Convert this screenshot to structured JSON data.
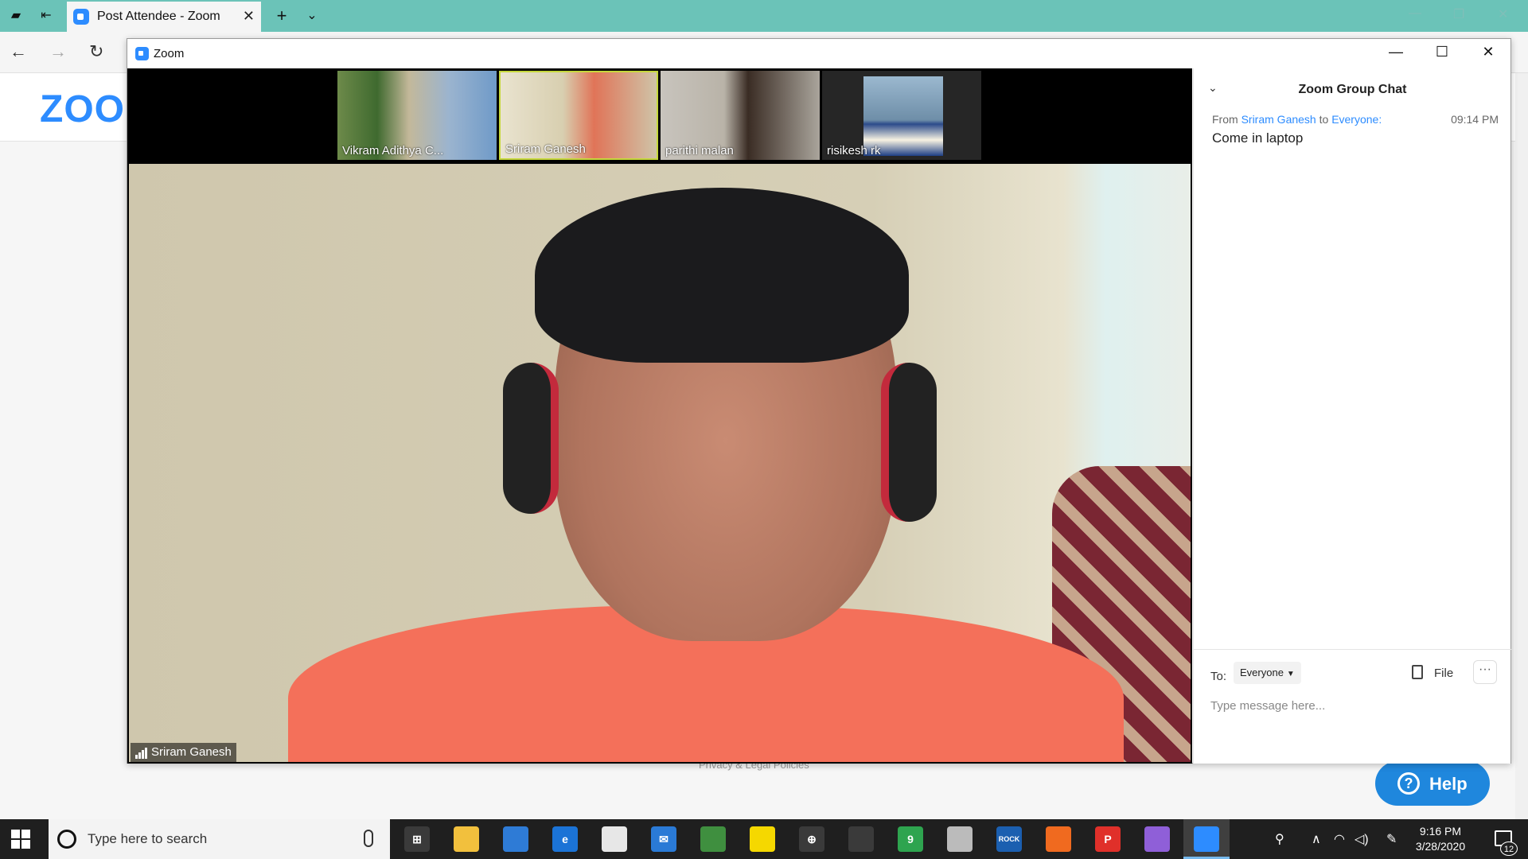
{
  "browser": {
    "tab_title": "Post Attendee - Zoom"
  },
  "page": {
    "logo_text": "ZOOM",
    "footer_link": "Privacy & Legal Policies",
    "help_label": "Help",
    "help_icon": "?"
  },
  "zoom_window": {
    "title": "Zoom",
    "participants": [
      {
        "name": "Vikram Adithya C..."
      },
      {
        "name": "Sriram Ganesh"
      },
      {
        "name": "parithi malan"
      },
      {
        "name": "risikesh rk"
      }
    ],
    "active_speaker": "Sriram Ganesh"
  },
  "chat": {
    "title": "Zoom Group Chat",
    "messages": [
      {
        "from_label": "From",
        "sender": "Sriram Ganesh",
        "to_label": "to",
        "recipient": "Everyone:",
        "time": "09:14 PM",
        "text": "Come in laptop"
      }
    ],
    "to_label": "To:",
    "to_value": "Everyone",
    "file_label": "File",
    "more_label": "···",
    "input_placeholder": "Type message here..."
  },
  "taskbar": {
    "search_placeholder": "Type here to search",
    "apps": [
      {
        "name": "task-view-icon",
        "glyph": "⊞"
      },
      {
        "name": "file-explorer-icon",
        "glyph": ""
      },
      {
        "name": "store-icon",
        "glyph": ""
      },
      {
        "name": "edge-icon",
        "glyph": "e"
      },
      {
        "name": "clock-app-icon",
        "glyph": ""
      },
      {
        "name": "mail-icon",
        "glyph": "✉"
      },
      {
        "name": "photos-icon",
        "glyph": ""
      },
      {
        "name": "sticky-notes-icon",
        "glyph": ""
      },
      {
        "name": "crosshair-icon",
        "glyph": "⊕"
      },
      {
        "name": "game-icon",
        "glyph": ""
      },
      {
        "name": "chrome-icon",
        "glyph": "9"
      },
      {
        "name": "screen-icon",
        "glyph": ""
      },
      {
        "name": "rock-app-icon",
        "glyph": "ROCK"
      },
      {
        "name": "firefox-icon",
        "glyph": ""
      },
      {
        "name": "pocket-icon",
        "glyph": "P"
      },
      {
        "name": "maps-pin-icon",
        "glyph": ""
      },
      {
        "name": "zoom-taskbar-icon",
        "glyph": ""
      }
    ],
    "time": "9:16 PM",
    "date": "3/28/2020",
    "notification_count": "12"
  },
  "colors": {
    "tab_bar": "#6bc3b8",
    "zoom_blue": "#2d8cff",
    "help_blue": "#1f87dd",
    "active_speaker_border": "#c6d83c",
    "taskbar": "#1f1f1f"
  }
}
